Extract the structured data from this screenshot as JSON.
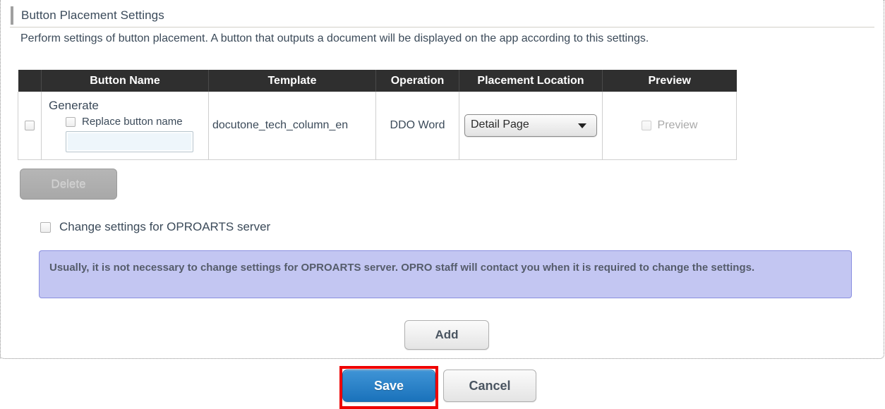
{
  "header": {
    "title": "Button Placement Settings",
    "description": "Perform settings of button placement. A button that outputs a document will be displayed on the app according to this settings."
  },
  "table": {
    "columns": [
      "",
      "Button Name",
      "Template",
      "Operation",
      "Placement Location",
      "Preview"
    ],
    "rows": [
      {
        "selected": false,
        "button_name": "Generate",
        "replace_checkbox_label": "Replace button name",
        "replace_checked": false,
        "replace_value": "",
        "replace_placeholder": "",
        "template": "docutone_tech_column_en",
        "operation": "DDO Word",
        "placement_location": "Detail Page",
        "placement_options": [
          "Detail Page"
        ],
        "preview_label": "Preview",
        "preview_checked": false
      }
    ]
  },
  "actions": {
    "delete_label": "Delete",
    "add_label": "Add",
    "save_label": "Save",
    "cancel_label": "Cancel"
  },
  "server_settings": {
    "checkbox_label": "Change settings for OPROARTS server",
    "checked": false,
    "notice": "Usually, it is not necessary to change settings for OPROARTS server. OPRO staff will contact you when it is required to change the settings."
  },
  "colors": {
    "accent_blue": "#1a72bb",
    "highlight_red": "#ee0000",
    "notice_bg": "#c3c6f2",
    "header_bg": "#2f2f2f"
  }
}
